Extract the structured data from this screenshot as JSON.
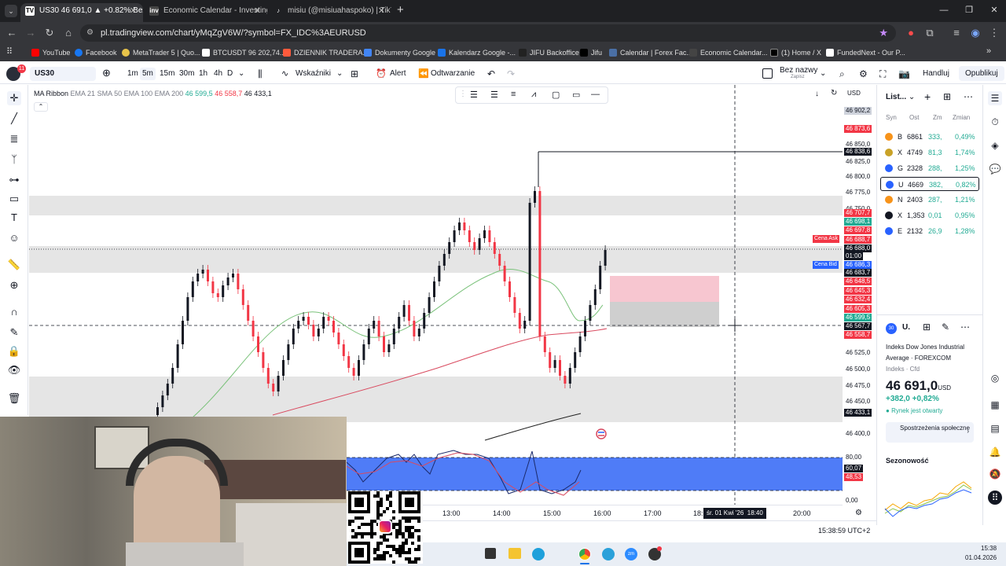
{
  "browser": {
    "tabs": [
      {
        "title": "US30 46 691,0 ▲ +0.82% Bez n",
        "icon": "tradingview"
      },
      {
        "title": "Economic Calendar - Investing.",
        "icon": "investing"
      },
      {
        "title": "misiu (@misiuahaspoko) | TikTo",
        "icon": "tiktok"
      }
    ],
    "new_tab": "+",
    "url": "pl.tradingview.com/chart/yMqZgV6W/?symbol=FX_IDC%3AEURUSD",
    "bookmarks": [
      "YouTube",
      "Facebook",
      "MetaTrader 5 | Quo...",
      "BTCUSDT 96 202,74...",
      "DZIENNIK TRADERA...",
      "Dokumenty Google",
      "Kalendarz Google -...",
      "JIFU Backoffice",
      "Jifu",
      "Calendar | Forex Fac...",
      "Economic Calendar...",
      "(1) Home / X",
      "FundedNext - Our P..."
    ],
    "all_bookmarks": "»"
  },
  "toolbar": {
    "symbol": "US30",
    "avatar_badge": "11",
    "intervals": [
      "1m",
      "5m",
      "15m",
      "30m",
      "1h",
      "4h",
      "D"
    ],
    "active_interval": "5m",
    "indicators": "Wskaźniki",
    "alert": "Alert",
    "replay": "Odtwarzanie",
    "layout_name": "Bez nazwy",
    "layout_save": "Zapisz",
    "trade": "Handluj",
    "publish": "Opublikuj"
  },
  "chart": {
    "legend": {
      "name": "MA Ribbon",
      "params": "EMA 21 SMA 50 EMA 100 EMA 200",
      "v1": "46 599,5",
      "v2": "46 558,7",
      "v3": "46 433,1"
    },
    "currency": "USD",
    "price_labels": [
      "46 850,0",
      "46 825,0",
      "46 800,0",
      "46 775,0",
      "46 750,0",
      "46 525,0",
      "46 500,0",
      "46 475,0",
      "46 450,0",
      "46 400,0"
    ],
    "price_tags": [
      {
        "text": "46 902,2",
        "bg": "#cfd3dc",
        "fg": "#131722"
      },
      {
        "text": "46 873,6",
        "bg": "#f23645",
        "fg": "#ffffff"
      },
      {
        "text": "46 838,6",
        "bg": "#131722",
        "fg": "#ffffff"
      },
      {
        "text": "46 707,7",
        "bg": "#f23645",
        "fg": "#ffffff"
      },
      {
        "text": "46 698,1",
        "bg": "#22ab94",
        "fg": "#ffffff"
      },
      {
        "text": "46 697,8",
        "bg": "#f23645",
        "fg": "#ffffff"
      },
      {
        "text": "46 688,7",
        "bg": "#f23645",
        "fg": "#ffffff"
      },
      {
        "text": "46 688,0",
        "bg": "#131722",
        "fg": "#ffffff"
      },
      {
        "text": "01:00",
        "bg": "#131722",
        "fg": "#ffffff"
      },
      {
        "text": "46 686,3",
        "bg": "#2962ff",
        "fg": "#ffffff"
      },
      {
        "text": "46 683,7",
        "bg": "#131722",
        "fg": "#ffffff"
      },
      {
        "text": "46 648,5",
        "bg": "#f23645",
        "fg": "#ffffff"
      },
      {
        "text": "46 645,3",
        "bg": "#f23645",
        "fg": "#ffffff"
      },
      {
        "text": "46 632,4",
        "bg": "#f23645",
        "fg": "#ffffff"
      },
      {
        "text": "46 605,3",
        "bg": "#f23645",
        "fg": "#ffffff"
      },
      {
        "text": "46 599,5",
        "bg": "#22ab94",
        "fg": "#ffffff"
      },
      {
        "text": "46 567,7",
        "bg": "#131722",
        "fg": "#ffffff"
      },
      {
        "text": "46 558,7",
        "bg": "#f23645",
        "fg": "#ffffff"
      },
      {
        "text": "46 433,1",
        "bg": "#131722",
        "fg": "#ffffff"
      }
    ],
    "ask_label": "Cena Ask",
    "bid_label": "Cena Bid",
    "osc_labels": [
      "80,00",
      "0,00"
    ],
    "osc_tags": [
      {
        "text": "60,07",
        "bg": "#131722"
      },
      {
        "text": "48,53",
        "bg": "#f23645"
      }
    ],
    "time_labels": [
      "13:00",
      "14:00",
      "15:00",
      "16:00",
      "17:00",
      "18:",
      "20:00"
    ],
    "crosshair_time": "śr. 01 Kwi '26  18:40",
    "clock": "15:38:59 UTC+2"
  },
  "watchlist": {
    "title": "List...",
    "headers": [
      "Syn",
      "Ost",
      "Zm",
      "Zmian"
    ],
    "rows": [
      {
        "sym": "B",
        "last": "6861",
        "chg": "333,",
        "pct": "0,49%",
        "color": "#f7931a",
        "pos": true
      },
      {
        "sym": "X",
        "last": "4749",
        "chg": "81,3",
        "pct": "1,74%",
        "color": "#c9a227",
        "pos": true
      },
      {
        "sym": "G",
        "last": "2328",
        "chg": "288,",
        "pct": "1,25%",
        "color": "#2962ff",
        "pos": true
      },
      {
        "sym": "U",
        "last": "4669",
        "chg": "382,",
        "pct": "0,82%",
        "color": "#2962ff",
        "pos": true
      },
      {
        "sym": "N",
        "last": "2403",
        "chg": "287,",
        "pct": "1,21%",
        "color": "#f7931a",
        "pos": true
      },
      {
        "sym": "X",
        "last": "1,353",
        "chg": "0,01",
        "pct": "0,95%",
        "color": "#131722",
        "pos": true
      },
      {
        "sym": "E",
        "last": "2132",
        "chg": "26,9",
        "pct": "1,28%",
        "color": "#2962ff",
        "pos": true
      }
    ],
    "details": {
      "short": "U.",
      "name_line1": "Indeks Dow Jones Industrial",
      "name_line2": "Average",
      "exchange": "FOREXCOM",
      "meta": "Indeks · Cfd",
      "price": "46 691,0",
      "price_ccy": "USD",
      "change": "+382,0 +0,82%",
      "market_status": "Rynek jest otwarty",
      "community": "Spostrzeżenia społeczne",
      "seasonality": "Sezonowość"
    }
  },
  "taskbar": {
    "time": "15:38",
    "date": "01.04.2026"
  }
}
